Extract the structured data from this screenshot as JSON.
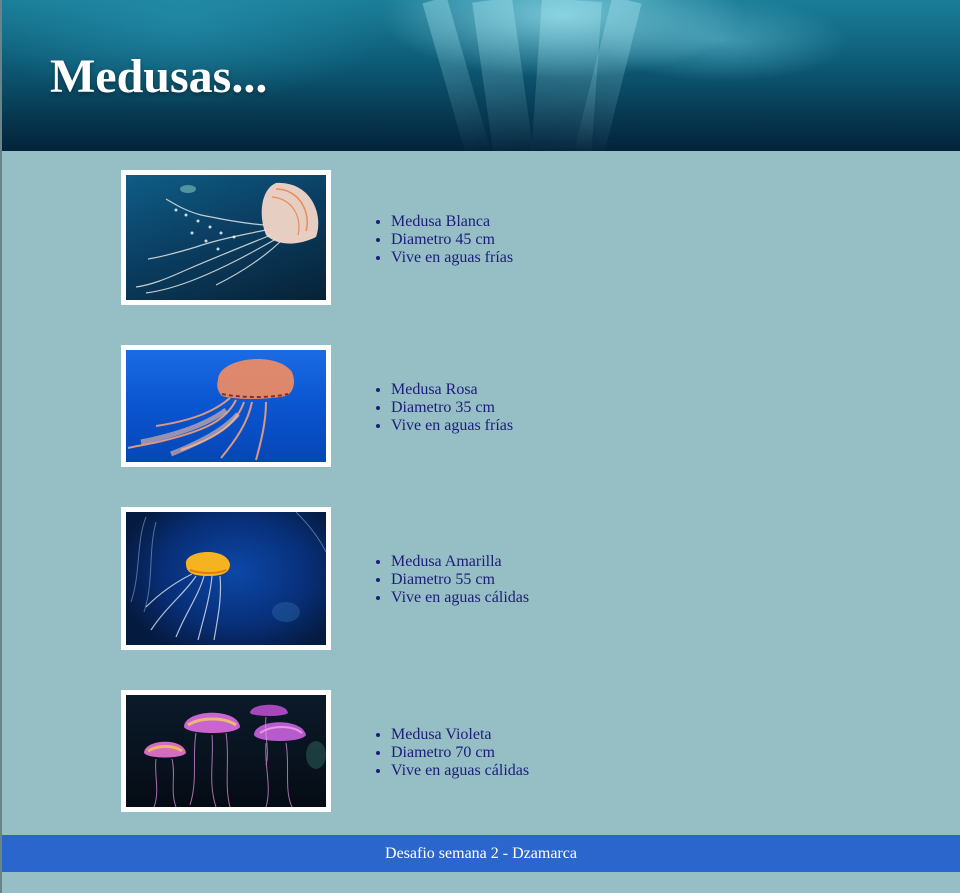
{
  "header": {
    "title": "Medusas..."
  },
  "jellyfish": [
    {
      "image_label": "Medusa Blanca photo",
      "name": "Medusa Blanca",
      "diameter": "Diametro 45 cm",
      "habitat": "Vive en aguas frías",
      "color": "#f3d6c8"
    },
    {
      "image_label": "Medusa Rosa photo",
      "name": "Medusa Rosa",
      "diameter": "Diametro 35 cm",
      "habitat": "Vive en aguas frías",
      "color": "#e98a66"
    },
    {
      "image_label": "Medusa Amarilla photo",
      "name": "Medusa Amarilla",
      "diameter": "Diametro 55 cm",
      "habitat": "Vive en aguas cálidas",
      "color": "#f5b322"
    },
    {
      "image_label": "Medusa Violeta photo",
      "name": "Medusa Violeta",
      "diameter": "Diametro 70 cm",
      "habitat": "Vive en aguas cálidas",
      "color": "#d56ad9"
    }
  ],
  "footer": {
    "text": "Desafio semana 2 - Dzamarca"
  }
}
